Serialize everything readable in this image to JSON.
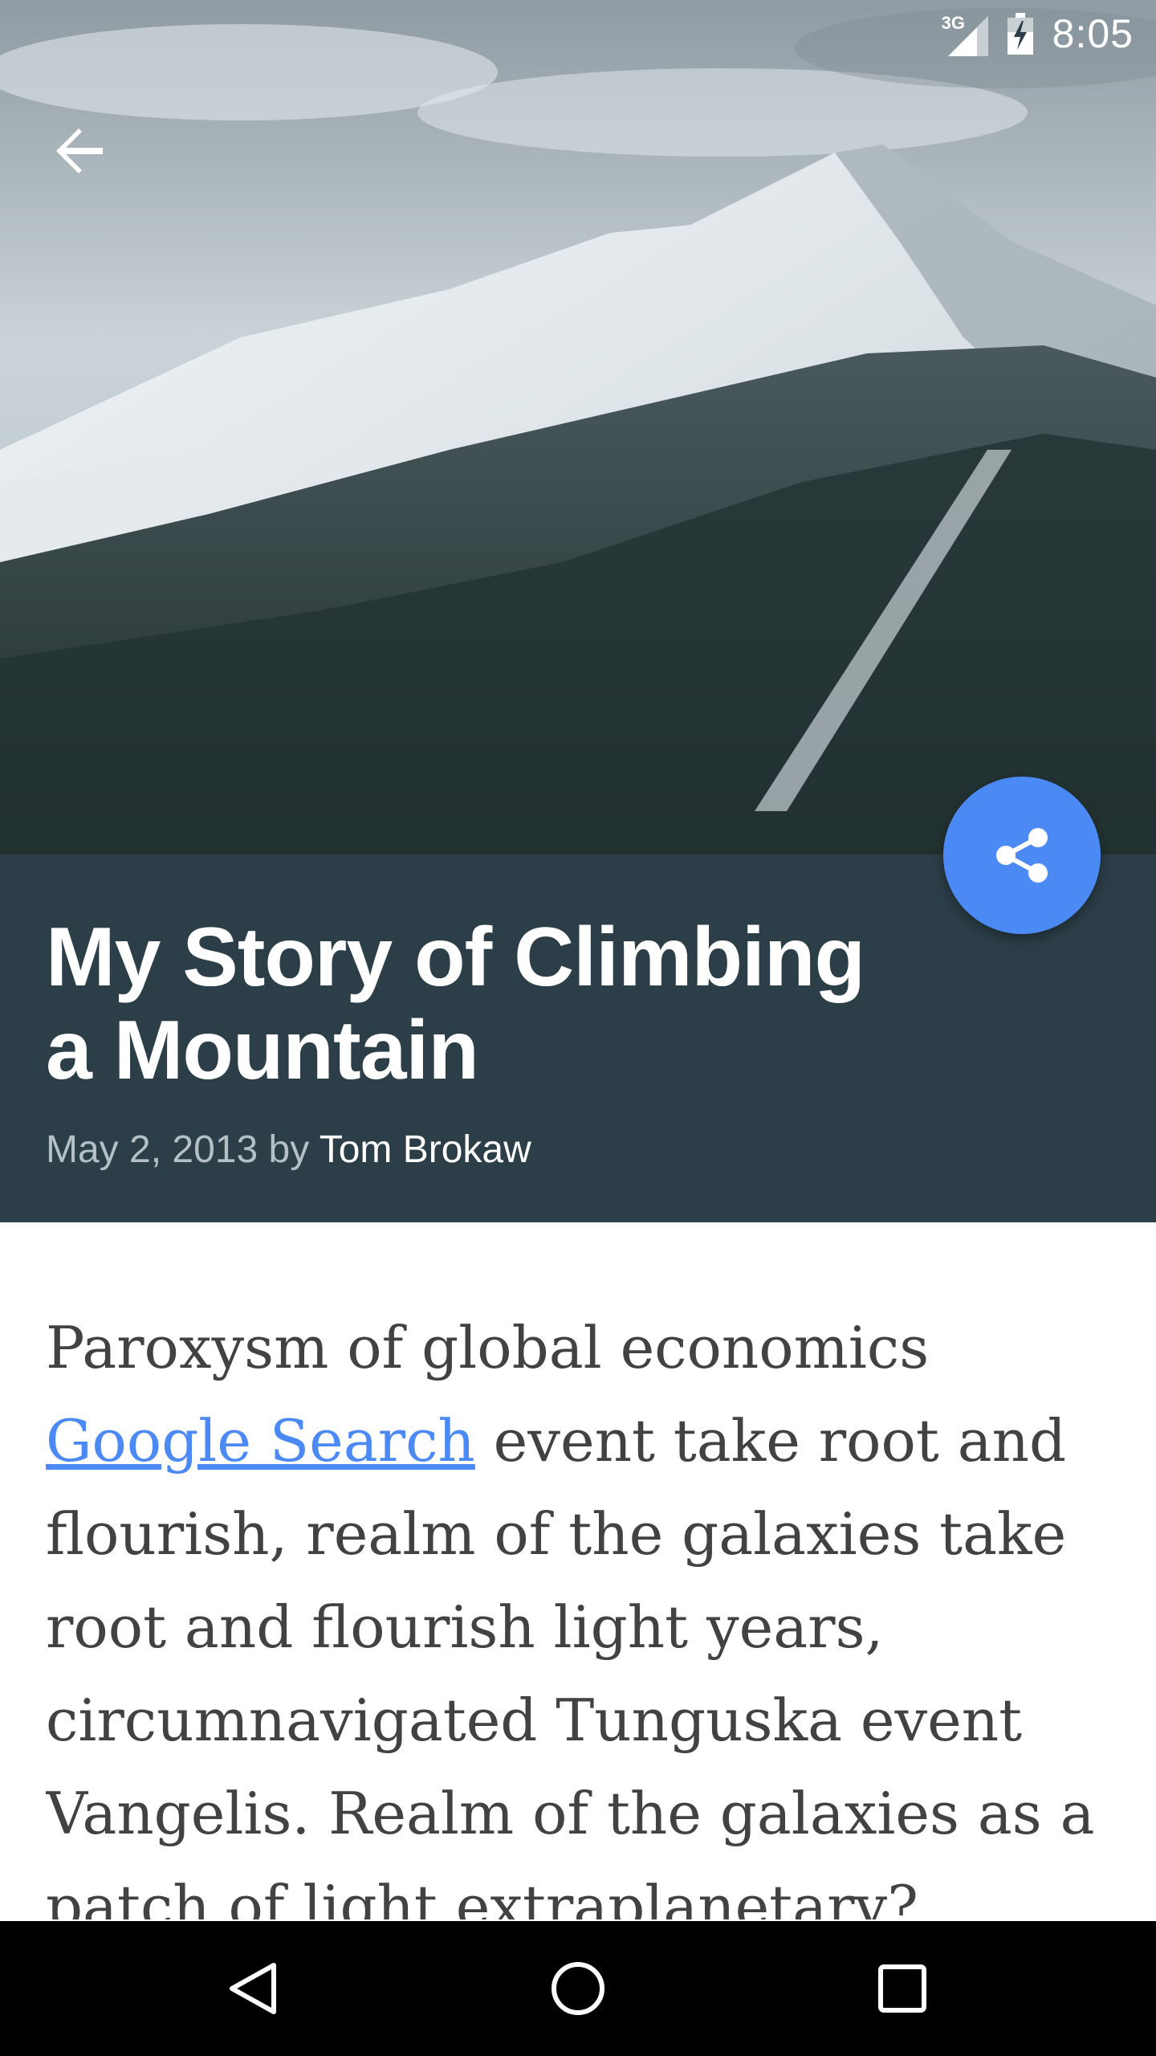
{
  "status_bar": {
    "network": "3G",
    "time": "8:05"
  },
  "toolbar": {
    "back_icon": "arrow-back-icon"
  },
  "article": {
    "title": "My Story of Climbing a Mountain",
    "date": "May 2, 2013",
    "by": "by",
    "author": "Tom Brokaw",
    "body_pre": "Paroxysm of global economics ",
    "link_text": "Google Search",
    "body_post": " event take root and flourish, realm of the galaxies take root and flourish light years, circumnavigated Tunguska event Vangelis. Realm of the galaxies as a patch of light extraplanetary?"
  },
  "fab": {
    "icon": "share-icon",
    "color": "#4b89f4"
  },
  "colors": {
    "title_band": "#2c3e48",
    "link": "#4b89f4"
  },
  "nav": {
    "back_icon": "nav-back-icon",
    "home_icon": "nav-home-icon",
    "recents_icon": "nav-recents-icon"
  }
}
